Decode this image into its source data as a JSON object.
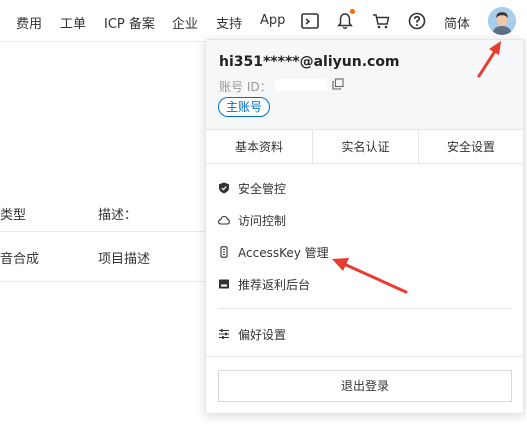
{
  "topbar": {
    "nav": [
      "费用",
      "工单",
      "ICP 备案",
      "企业",
      "支持",
      "App"
    ],
    "language": "简体"
  },
  "background": {
    "headers": [
      "类型",
      "描述："
    ],
    "row": [
      "音合成",
      "项目描述"
    ]
  },
  "dropdown": {
    "email": "hi351*****@aliyun.com",
    "account_id_label": "账号 ID：",
    "badge": "主账号",
    "tabs": [
      "基本资料",
      "实名认证",
      "安全设置"
    ],
    "menu": [
      {
        "label": "安全管控",
        "icon": "shield-icon"
      },
      {
        "label": "访问控制",
        "icon": "cloud-icon"
      },
      {
        "label": "AccessKey 管理",
        "icon": "key-icon"
      },
      {
        "label": "推荐返利后台",
        "icon": "wallet-icon"
      }
    ],
    "preferences": "偏好设置",
    "logout": "退出登录"
  },
  "colors": {
    "accent_blue": "#0070cc",
    "annotation_red": "#e83a2f",
    "notification_dot": "#ff6a00"
  }
}
